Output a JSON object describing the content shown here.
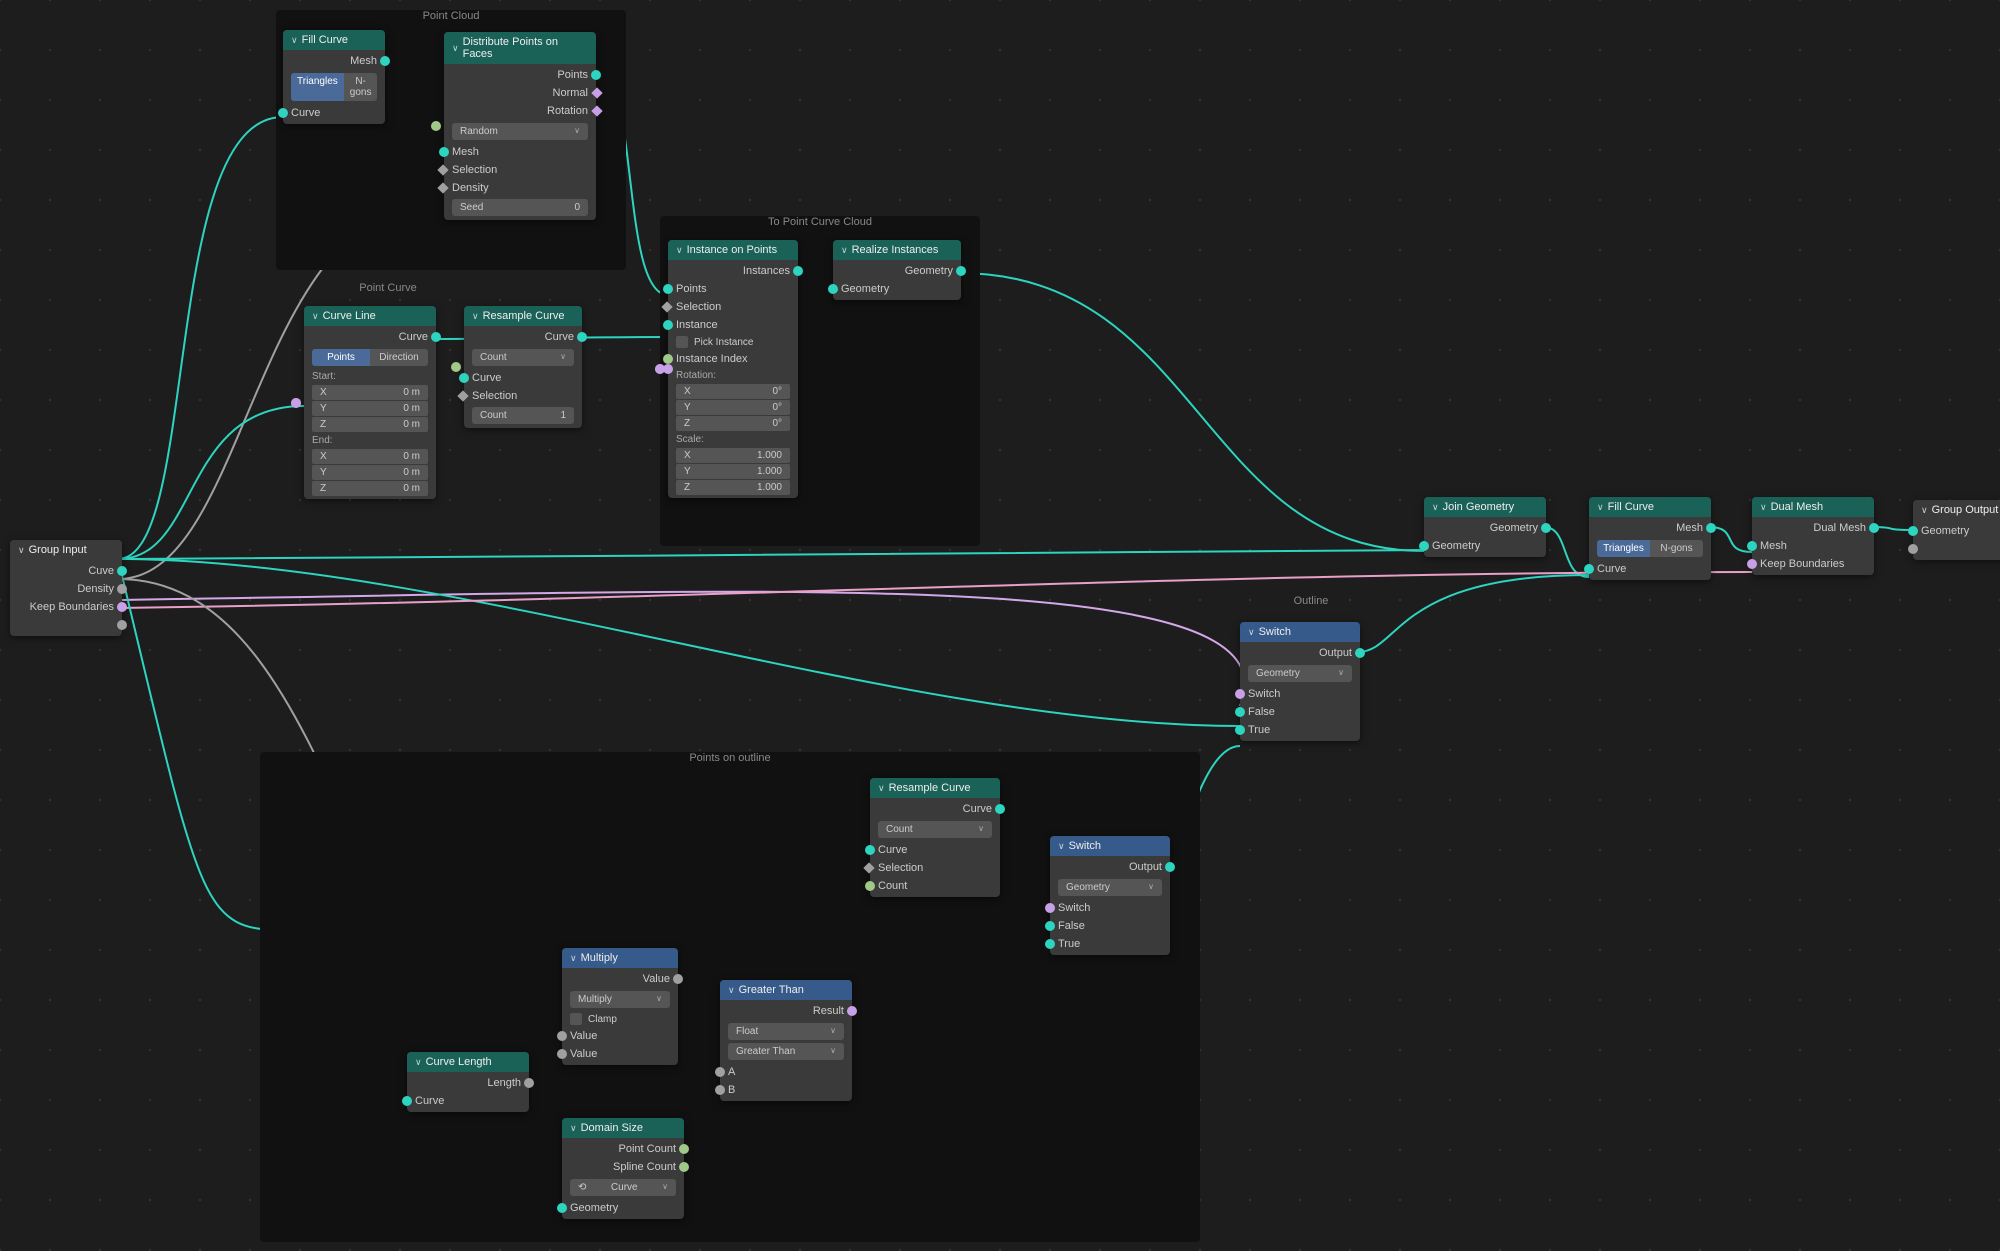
{
  "frames": {
    "pointCloud": "Point Cloud",
    "pointCurve": "Point Curve",
    "toPointCurveCloud": "To Point Curve Cloud",
    "outline": "Outline",
    "pointsOnOutline": "Points on outline"
  },
  "groupInput": {
    "title": "Group Input",
    "cuve": "Cuve",
    "density": "Density",
    "keepBoundaries": "Keep Boundaries"
  },
  "fillCurve1": {
    "title": "Fill Curve",
    "mesh": "Mesh",
    "triangles": "Triangles",
    "ngons": "N-gons",
    "curve": "Curve"
  },
  "distribute": {
    "title": "Distribute Points on Faces",
    "points": "Points",
    "normal": "Normal",
    "rotation": "Rotation",
    "random": "Random",
    "mesh": "Mesh",
    "selection": "Selection",
    "density": "Density",
    "seedLabel": "Seed",
    "seedVal": "0"
  },
  "curveLine": {
    "title": "Curve Line",
    "curve": "Curve",
    "points": "Points",
    "direction": "Direction",
    "start": "Start:",
    "end": "End:",
    "x": "X",
    "y": "Y",
    "z": "Z",
    "zm": "0 m"
  },
  "resample1": {
    "title": "Resample Curve",
    "curve": "Curve",
    "count": "Count",
    "selection": "Selection",
    "countLabel": "Count",
    "countVal": "1"
  },
  "instance": {
    "title": "Instance on Points",
    "instances": "Instances",
    "points": "Points",
    "selection": "Selection",
    "instance": "Instance",
    "pickInstance": "Pick Instance",
    "instanceIndex": "Instance Index",
    "rotation": "Rotation:",
    "scale": "Scale:",
    "x": "X",
    "y": "Y",
    "z": "Z",
    "zero": "0°",
    "one": "1.000"
  },
  "realize": {
    "title": "Realize Instances",
    "geometry": "Geometry"
  },
  "joinGeo": {
    "title": "Join Geometry",
    "geometry": "Geometry"
  },
  "fillCurve2": {
    "title": "Fill Curve",
    "mesh": "Mesh",
    "triangles": "Triangles",
    "ngons": "N-gons",
    "curve": "Curve"
  },
  "dualMesh": {
    "title": "Dual Mesh",
    "dualMesh": "Dual Mesh",
    "mesh": "Mesh",
    "keepBoundaries": "Keep Boundaries"
  },
  "groupOutput": {
    "title": "Group Output",
    "geometry": "Geometry"
  },
  "switch1": {
    "title": "Switch",
    "output": "Output",
    "geometry": "Geometry",
    "switch": "Switch",
    "false": "False",
    "true": "True"
  },
  "resample2": {
    "title": "Resample Curve",
    "curve": "Curve",
    "count": "Count",
    "selection": "Selection",
    "countOut": "Count"
  },
  "switch2": {
    "title": "Switch",
    "output": "Output",
    "geometry": "Geometry",
    "switch": "Switch",
    "false": "False",
    "true": "True"
  },
  "curveLength": {
    "title": "Curve Length",
    "length": "Length",
    "curve": "Curve"
  },
  "multiply": {
    "title": "Multiply",
    "value": "Value",
    "multiply": "Multiply",
    "clamp": "Clamp"
  },
  "greaterThan": {
    "title": "Greater Than",
    "result": "Result",
    "float": "Float",
    "greaterThan": "Greater Than",
    "a": "A",
    "b": "B"
  },
  "domainSize": {
    "title": "Domain Size",
    "pointCount": "Point Count",
    "splineCount": "Spline Count",
    "curve": "Curve",
    "geometry": "Geometry"
  }
}
